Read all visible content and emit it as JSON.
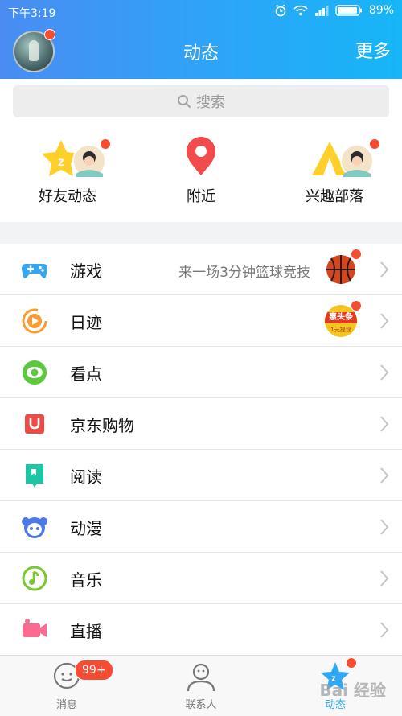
{
  "status_bar": {
    "time": "下午3:19",
    "battery": "89%"
  },
  "header": {
    "title": "动态",
    "more": "更多"
  },
  "search": {
    "placeholder": "搜索"
  },
  "quick_entries": [
    {
      "label": "好友动态"
    },
    {
      "label": "附近"
    },
    {
      "label": "兴趣部落"
    }
  ],
  "list": [
    {
      "label": "游戏",
      "note": "来一场3分钟篮球竞技",
      "icon": "gamepad-icon",
      "color": "#35a6ef"
    },
    {
      "label": "日迹",
      "note": "",
      "icon": "play-circle-icon",
      "color": "#f99b32",
      "thumb_text": "惠头条",
      "thumb_subtext": "1元提现"
    },
    {
      "label": "看点",
      "note": "",
      "icon": "eye-icon",
      "color": "#5cc83c"
    },
    {
      "label": "京东购物",
      "note": "",
      "icon": "bag-icon",
      "color": "#f04a44"
    },
    {
      "label": "阅读",
      "note": "",
      "icon": "book-icon",
      "color": "#1cc6a5"
    },
    {
      "label": "动漫",
      "note": "",
      "icon": "anime-face-icon",
      "color": "#4c79ea"
    },
    {
      "label": "音乐",
      "note": "",
      "icon": "music-note-icon",
      "color": "#77c92e"
    },
    {
      "label": "直播",
      "note": "",
      "icon": "video-camera-icon",
      "color": "#fb6a90"
    }
  ],
  "tabs": [
    {
      "label": "消息",
      "badge": "99+"
    },
    {
      "label": "联系人"
    },
    {
      "label": "动态"
    }
  ],
  "watermark": "Bai 经验"
}
